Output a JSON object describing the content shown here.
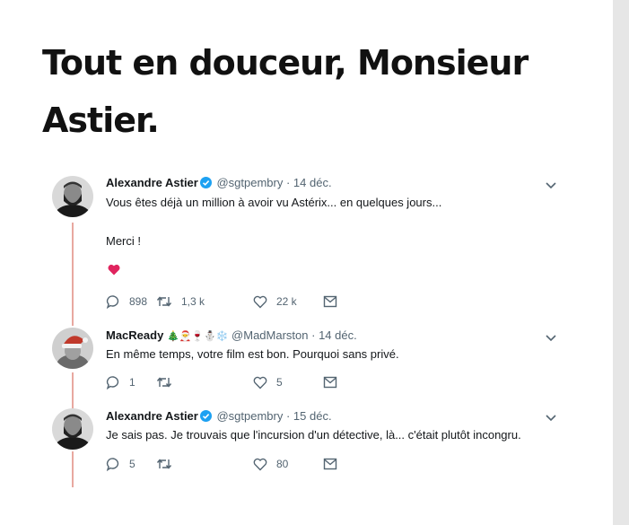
{
  "article": {
    "headline": "Tout en douceur, Monsieur Astier."
  },
  "tweets": [
    {
      "author": "Alexandre Astier",
      "handle": "@sgtpembry",
      "date": "· 14 déc.",
      "lines": [
        "Vous êtes déjà un million à avoir vu Astérix... en quelques jours...",
        "Merci !"
      ],
      "emoji": "heart",
      "replies": "898",
      "retweets": "1,3 k",
      "likes": "22 k",
      "verified": true,
      "avatar": "bearded-man"
    },
    {
      "author": "MacReady",
      "author_emoji": "🎄🎅🍷⛄❄️",
      "handle": "@MadMarston",
      "date": "· 14 déc.",
      "lines": [
        "En même temps, votre film est bon. Pourquoi sans privé."
      ],
      "replies": "1",
      "retweets": "",
      "likes": "5",
      "verified": false,
      "avatar": "santa-hat-figure"
    },
    {
      "author": "Alexandre Astier",
      "handle": "@sgtpembry",
      "date": "· 15 déc.",
      "lines": [
        "Je sais pas. Je trouvais que l'incursion d'un détective, là... c'était plutôt incongru."
      ],
      "replies": "5",
      "retweets": "",
      "likes": "80",
      "verified": true,
      "avatar": "bearded-man"
    }
  ],
  "colors": {
    "thread_line": "#e8a8a0",
    "verified": "#1da1f2",
    "heart": "#e0245e",
    "icon": "#536471"
  }
}
